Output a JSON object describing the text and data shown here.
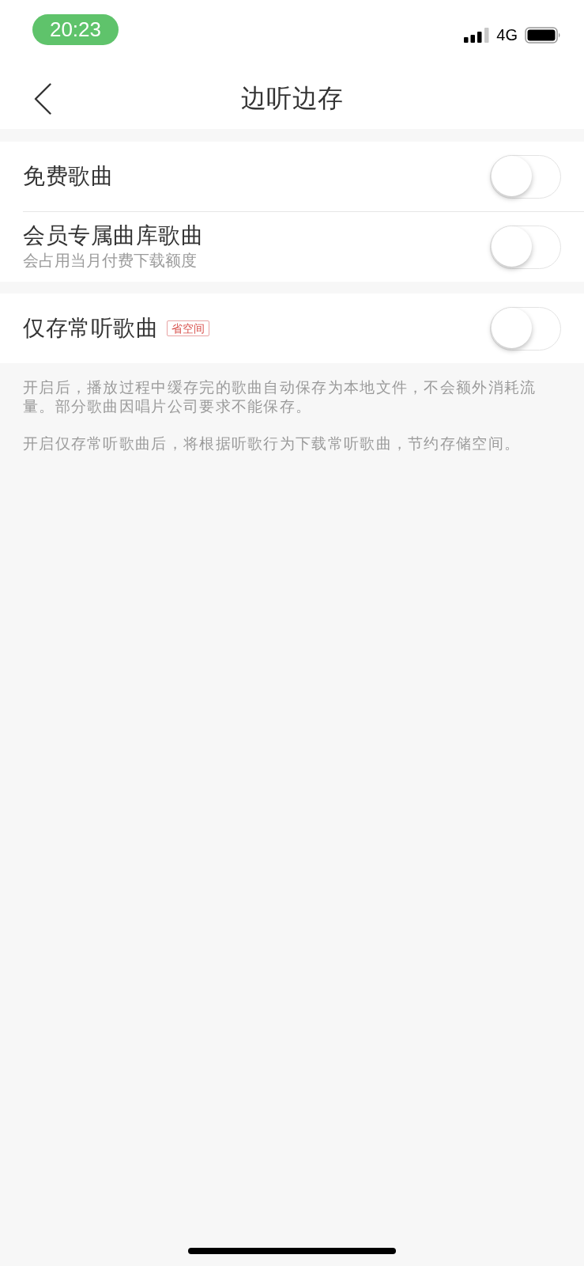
{
  "status_bar": {
    "time": "20:23",
    "network": "4G"
  },
  "header": {
    "title": "边听边存"
  },
  "sections": [
    {
      "rows": [
        {
          "label": "免费歌曲",
          "on": false
        },
        {
          "label": "会员专属曲库歌曲",
          "subtitle": "会占用当月付费下载额度",
          "on": false
        }
      ]
    },
    {
      "rows": [
        {
          "label": "仅存常听歌曲",
          "badge": "省空间",
          "on": false
        }
      ]
    }
  ],
  "notes": [
    "开启后，播放过程中缓存完的歌曲自动保存为本地文件，不会额外消耗流量。部分歌曲因唱片公司要求不能保存。",
    "开启仅存常听歌曲后，将根据听歌行为下载常听歌曲，节约存储空间。"
  ]
}
